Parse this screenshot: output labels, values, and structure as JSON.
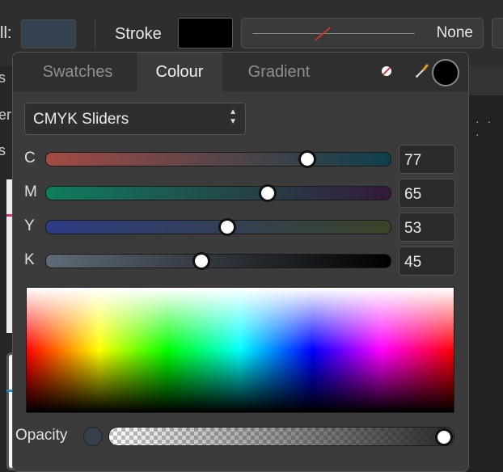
{
  "toolbar": {
    "fill_label": "ll:",
    "stroke_label": "Stroke",
    "stroke_style_value": "None",
    "fill_color": "#344150",
    "stroke_color": "#000000"
  },
  "background": {
    "left_fragments": [
      "s",
      "er",
      "s"
    ],
    "right_dots": "· · ·"
  },
  "panel": {
    "tabs": [
      {
        "label": "Swatches",
        "active": false
      },
      {
        "label": "Colour",
        "active": true
      },
      {
        "label": "Gradient",
        "active": false
      }
    ],
    "icons": {
      "no_colour": "no-colour-icon",
      "picker": "colour-picker-icon",
      "current": "current-colour-swatch"
    },
    "mode_select": {
      "value": "CMYK Sliders"
    },
    "sliders": [
      {
        "key": "C",
        "label": "C",
        "value": "77",
        "fraction": 0.77,
        "from": "#a34a44",
        "to": "#0d3f4d"
      },
      {
        "key": "M",
        "label": "M",
        "value": "65",
        "fraction": 0.65,
        "from": "#0f7c5e",
        "to": "#341a3a"
      },
      {
        "key": "Y",
        "label": "Y",
        "value": "53",
        "fraction": 0.53,
        "from": "#2e3c86",
        "to": "#394428"
      },
      {
        "key": "K",
        "label": "K",
        "value": "45",
        "fraction": 0.45,
        "from": "#5f6a78",
        "to": "#000000"
      }
    ],
    "opacity": {
      "label": "Opacity",
      "fraction": 1.0,
      "color": "#34404c"
    }
  }
}
